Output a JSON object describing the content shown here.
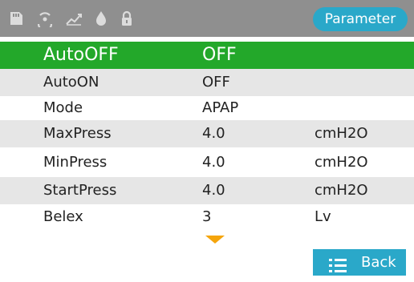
{
  "status_icons": [
    "sd-card-icon",
    "wireless-icon",
    "trend-chart-icon",
    "water-drop-icon",
    "lock-icon"
  ],
  "header": {
    "parameter_label": "Parameter"
  },
  "rows": [
    {
      "name": "AutoOFF",
      "value": "OFF",
      "unit": "",
      "selected": true
    },
    {
      "name": "AutoON",
      "value": "OFF",
      "unit": ""
    },
    {
      "name": "Mode",
      "value": "APAP",
      "unit": ""
    },
    {
      "name": "MaxPress",
      "value": "4.0",
      "unit": "cmH2O"
    },
    {
      "name": "MinPress",
      "value": "4.0",
      "unit": "cmH2O"
    },
    {
      "name": "StartPress",
      "value": "4.0",
      "unit": "cmH2O"
    },
    {
      "name": "Belex",
      "value": "3",
      "unit": "Lv"
    }
  ],
  "footer": {
    "back_label": "Back"
  },
  "colors": {
    "selected_row": "#23a82a",
    "accent": "#2aa8c9",
    "scroll_arrow": "#f5a50c",
    "status_bar": "#8f8f8f"
  }
}
